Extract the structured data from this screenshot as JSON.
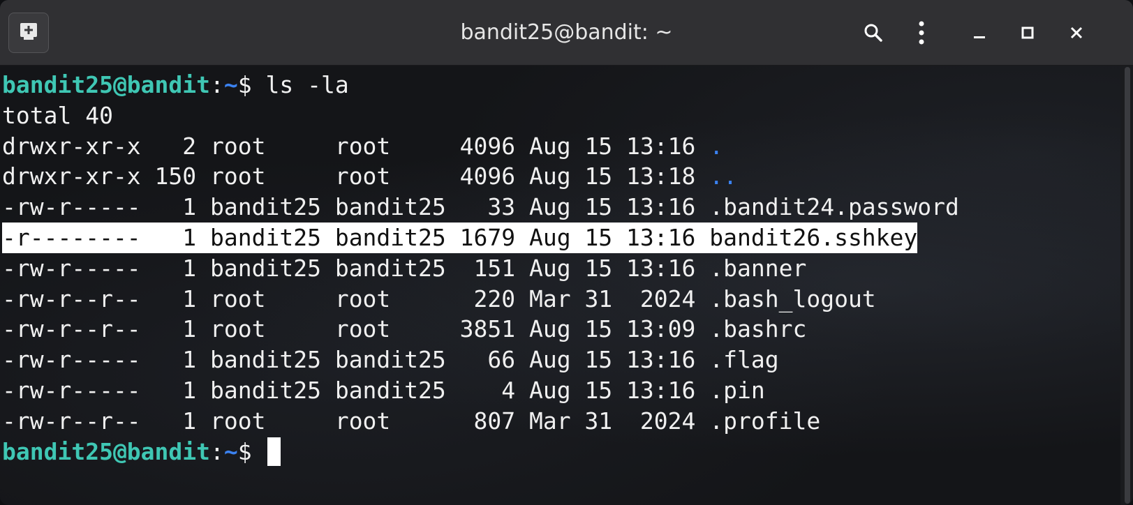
{
  "window": {
    "title": "bandit25@bandit: ~"
  },
  "titlebar_icons": {
    "new_tab": "new-tab-icon",
    "search": "search-icon",
    "menu": "kebab-menu-icon",
    "minimize": "minimize-icon",
    "maximize": "maximize-icon",
    "close": "close-icon"
  },
  "colors": {
    "prompt_user": "#3fc7b4",
    "prompt_path": "#3b82f0",
    "directory": "#3b82f0",
    "text": "#f0f0f0",
    "selection_bg": "#ffffff"
  },
  "terminal": {
    "command": {
      "user_host": "bandit25@bandit",
      "colon": ":",
      "path": "~",
      "symbol": "$ ",
      "input": "ls -la"
    },
    "total_line": "total 40",
    "entries": [
      {
        "meta": "drwxr-xr-x   2 root     root     4096 Aug 15 13:16 ",
        "name": ".",
        "type": "dir",
        "selected": false
      },
      {
        "meta": "drwxr-xr-x 150 root     root     4096 Aug 15 13:18 ",
        "name": "..",
        "type": "dir",
        "selected": false
      },
      {
        "meta": "-rw-r-----   1 bandit25 bandit25   33 Aug 15 13:16 ",
        "name": ".bandit24.password",
        "type": "file",
        "selected": false
      },
      {
        "meta": "-r--------   1 bandit25 bandit25 1679 Aug 15 13:16 ",
        "name": "bandit26.sshkey",
        "type": "file",
        "selected": true
      },
      {
        "meta": "-rw-r-----   1 bandit25 bandit25  151 Aug 15 13:16 ",
        "name": ".banner",
        "type": "file",
        "selected": false
      },
      {
        "meta": "-rw-r--r--   1 root     root      220 Mar 31  2024 ",
        "name": ".bash_logout",
        "type": "file",
        "selected": false
      },
      {
        "meta": "-rw-r--r--   1 root     root     3851 Aug 15 13:09 ",
        "name": ".bashrc",
        "type": "file",
        "selected": false
      },
      {
        "meta": "-rw-r-----   1 bandit25 bandit25   66 Aug 15 13:16 ",
        "name": ".flag",
        "type": "file",
        "selected": false
      },
      {
        "meta": "-rw-r-----   1 bandit25 bandit25    4 Aug 15 13:16 ",
        "name": ".pin",
        "type": "file",
        "selected": false
      },
      {
        "meta": "-rw-r--r--   1 root     root      807 Mar 31  2024 ",
        "name": ".profile",
        "type": "file",
        "selected": false
      }
    ],
    "prompt": {
      "user_host": "bandit25@bandit",
      "colon": ":",
      "path": "~",
      "symbol": "$ "
    }
  }
}
